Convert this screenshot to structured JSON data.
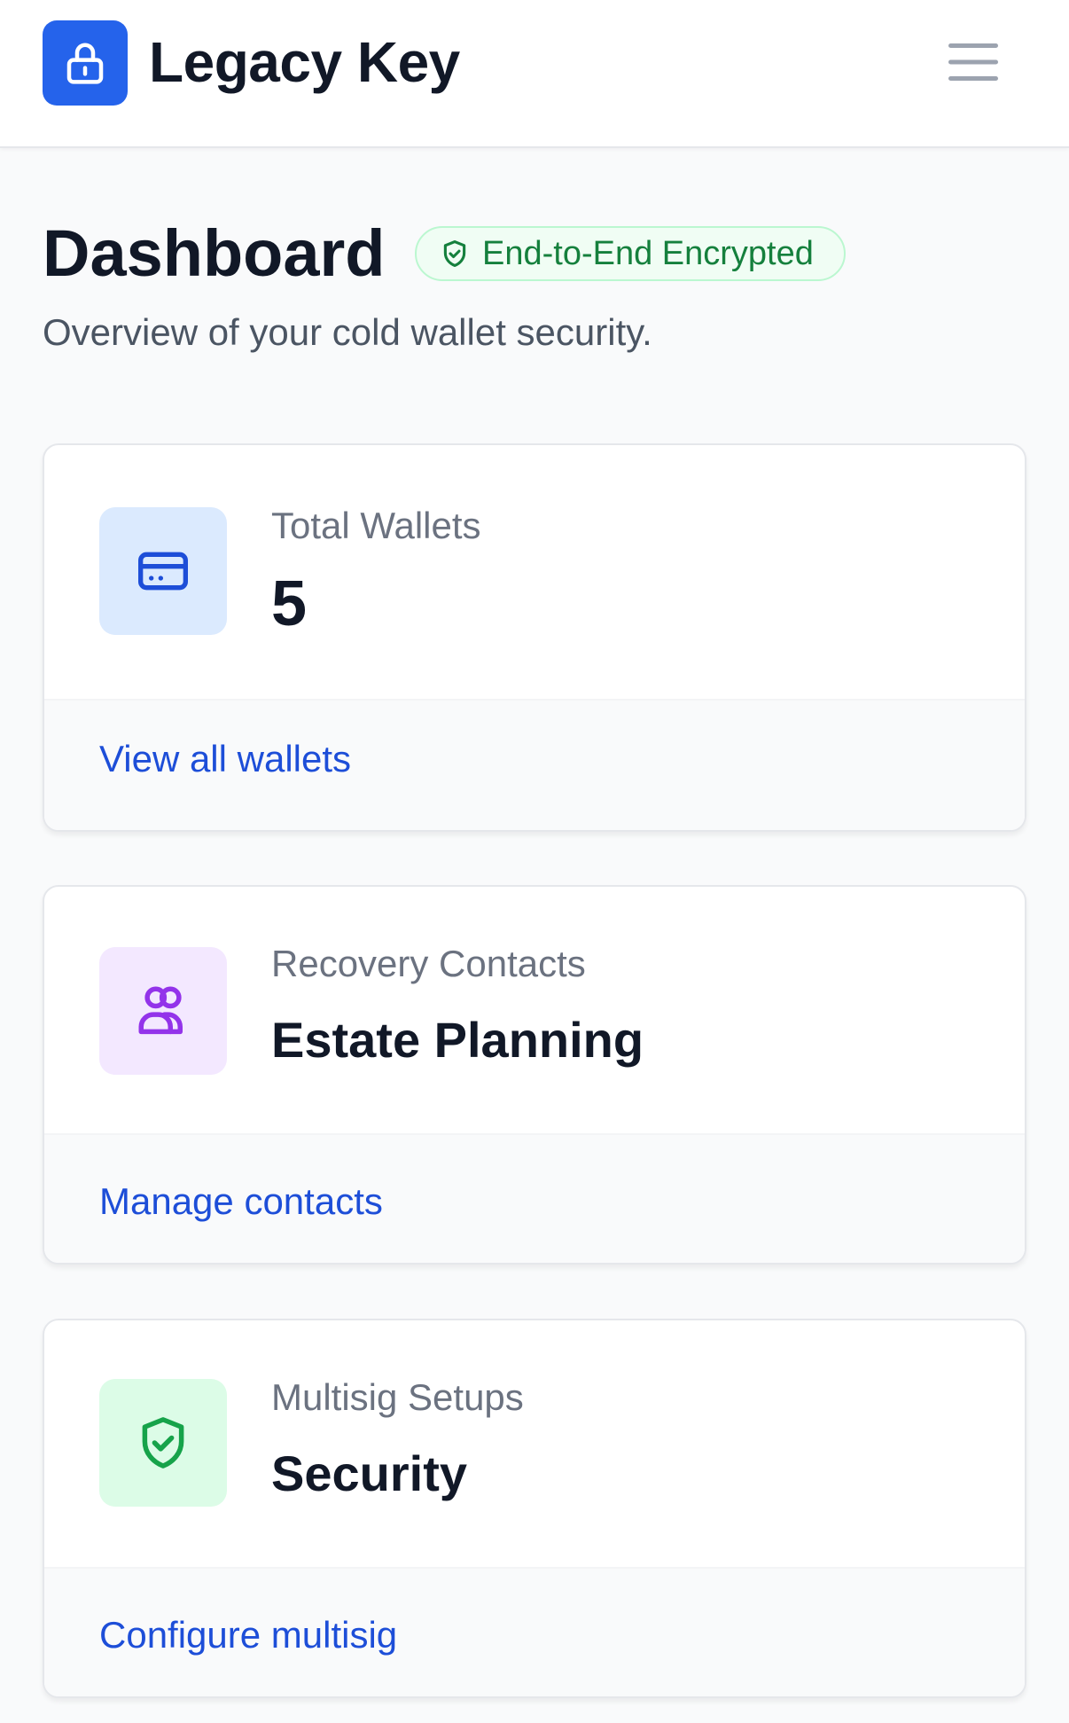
{
  "header": {
    "app_title": "Legacy Key",
    "logo_icon": "lock-icon",
    "menu_icon": "hamburger-menu-icon",
    "brand_color": "#2563eb"
  },
  "page": {
    "title": "Dashboard",
    "badge": "End-to-End Encrypted",
    "badge_icon": "shield-check-icon",
    "subtitle": "Overview of your cold wallet security."
  },
  "cards": [
    {
      "label": "Total Wallets",
      "value": "5",
      "link": "View all wallets",
      "icon": "credit-card-icon",
      "icon_bg": "#dbeafe",
      "icon_color": "#1d4ed8"
    },
    {
      "label": "Recovery Contacts",
      "value": "Estate Planning",
      "link": "Manage contacts",
      "icon": "users-icon",
      "icon_bg": "#f3e8ff",
      "icon_color": "#9333ea"
    },
    {
      "label": "Multisig Setups",
      "value": "Security",
      "link": "Configure multisig",
      "icon": "shield-check-icon",
      "icon_bg": "#dcfce7",
      "icon_color": "#16a34a"
    }
  ]
}
